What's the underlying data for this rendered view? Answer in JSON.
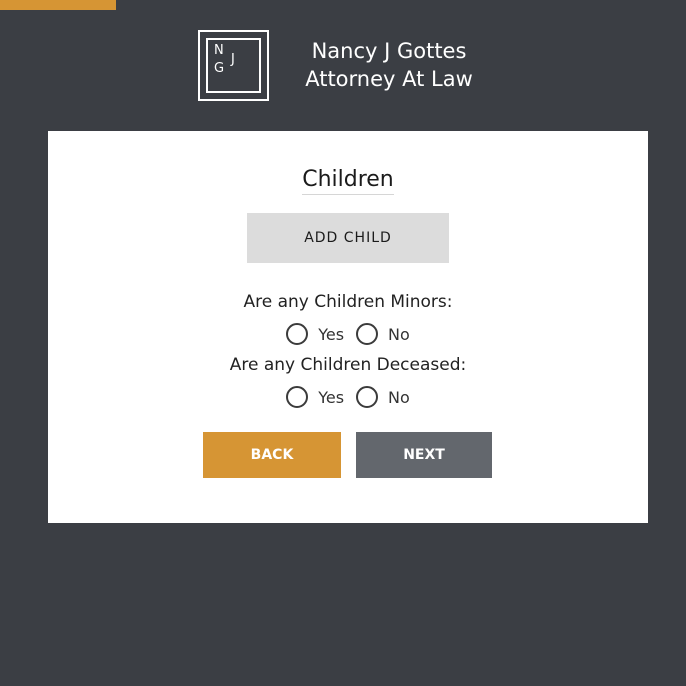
{
  "colors": {
    "background": "#3b3e44",
    "accent": "#d69534",
    "secondary_button": "#63676d",
    "card": "#ffffff"
  },
  "logo": {
    "letter_1": "N",
    "letter_2": "G",
    "letter_3": "J"
  },
  "header": {
    "firm_name_line1": "Nancy J Gottes",
    "firm_name_line2": "Attorney At Law"
  },
  "form": {
    "title": "Children",
    "add_child_label": "ADD CHILD",
    "questions": [
      {
        "label": "Are any Children Minors:",
        "options": [
          "Yes",
          "No"
        ]
      },
      {
        "label": "Are any Children Deceased:",
        "options": [
          "Yes",
          "No"
        ]
      }
    ],
    "back_label": "BACK",
    "next_label": "NEXT"
  }
}
